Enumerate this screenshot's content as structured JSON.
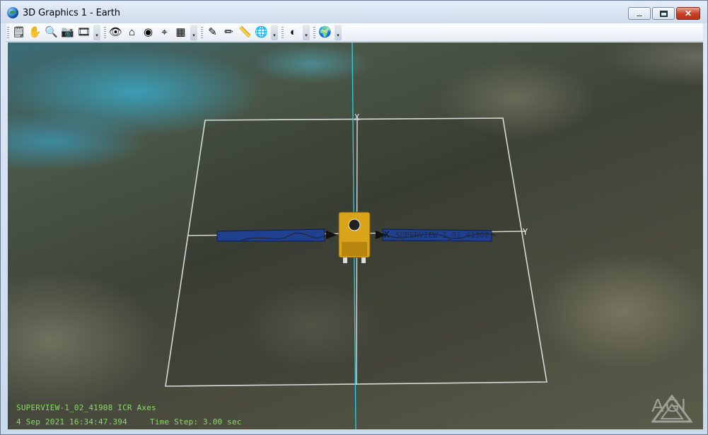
{
  "window": {
    "title": "3D Graphics 1 - Earth",
    "caption": {
      "minimize": "",
      "maximize": "",
      "close": "✕"
    }
  },
  "toolbar": {
    "groups": [
      [
        {
          "name": "properties-icon",
          "glyph": "🗒"
        },
        {
          "name": "pan-hand-icon",
          "glyph": "✋"
        },
        {
          "name": "zoom-icon",
          "glyph": "🔍"
        },
        {
          "name": "snapshot-icon",
          "glyph": "📷"
        },
        {
          "name": "record-movie-icon",
          "glyph": "🎞"
        }
      ],
      [
        {
          "name": "view-from-to-icon",
          "glyph": "👁"
        },
        {
          "name": "home-view-icon",
          "glyph": "⌂"
        },
        {
          "name": "view-object-icon",
          "glyph": "◉"
        },
        {
          "name": "orient-view-icon",
          "glyph": "⌖"
        },
        {
          "name": "stored-views-icon",
          "glyph": "▦"
        }
      ],
      [
        {
          "name": "highlight-pen-icon",
          "glyph": "✎"
        },
        {
          "name": "marker-pen-icon",
          "glyph": "✏"
        },
        {
          "name": "measure-ruler-icon",
          "glyph": "📏"
        },
        {
          "name": "globe-settings-icon",
          "glyph": "🌐"
        }
      ],
      [
        {
          "name": "terrain-globe-icon",
          "glyph": "◐"
        }
      ],
      [
        {
          "name": "earth-globe-icon",
          "glyph": "🌍"
        }
      ]
    ],
    "overflow_glyph": "▾"
  },
  "scene": {
    "axis_labels": {
      "x": "X",
      "y": "Y"
    },
    "satellite_label": "SUPERVIEW-1_02_41908",
    "body_axis_label": "X",
    "colors": {
      "grid": "#d9d9d9",
      "vertical_axis": "#2fd0e0",
      "solar_panel": "#1f3f8f",
      "bus_gold": "#d9a31a",
      "overlay_text": "#8bd96a"
    }
  },
  "status": {
    "axes_line": "SUPERVIEW-1_02_41908 ICR Axes",
    "date": "4 Sep 2021 16:34:47.394",
    "time_step": "Time Step: 3.00 sec"
  },
  "branding": {
    "logo_text": "AGI"
  }
}
